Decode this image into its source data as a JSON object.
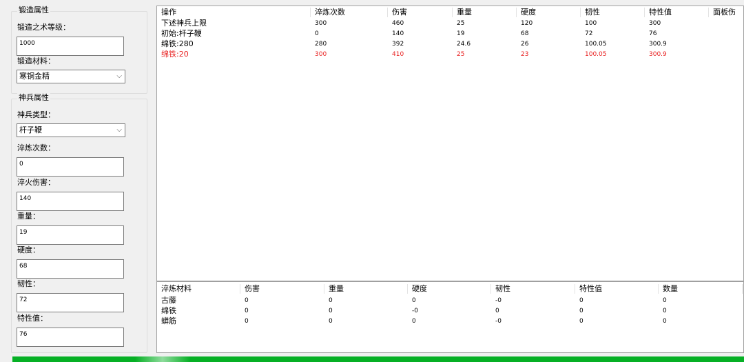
{
  "forge": {
    "title": "锻造属性",
    "level_label": "锻造之术等级：",
    "level_value": "1000",
    "material_label": "锻造材料：",
    "material_value": "寒铜金精"
  },
  "weapon": {
    "title": "神兵属性",
    "type_label": "神兵类型：",
    "type_value": "杆子鞭",
    "fields": [
      {
        "label": "淬炼次数：",
        "value": "0"
      },
      {
        "label": "淬火伤害：",
        "value": "140"
      },
      {
        "label": "重量：",
        "value": "19"
      },
      {
        "label": "硬度：",
        "value": "68"
      },
      {
        "label": "韧性：",
        "value": "72"
      },
      {
        "label": "特性值：",
        "value": "76"
      }
    ]
  },
  "ops_table": {
    "headers": [
      "操作",
      "淬炼次数",
      "伤害",
      "重量",
      "硬度",
      "韧性",
      "特性值",
      "面板伤"
    ],
    "rows": [
      {
        "cells": [
          "下述神兵上限",
          "300",
          "460",
          "25",
          "120",
          "100",
          "300"
        ],
        "highlight": false
      },
      {
        "cells": [
          "初始:杆子鞭",
          "0",
          "140",
          "19",
          "68",
          "72",
          "76"
        ],
        "highlight": false
      },
      {
        "cells": [
          "绵铁:280",
          "280",
          "392",
          "24.6",
          "26",
          "100.05",
          "300.9"
        ],
        "highlight": false
      },
      {
        "cells": [
          "绵铁:20",
          "300",
          "410",
          "25",
          "23",
          "100.05",
          "300.9"
        ],
        "highlight": true
      }
    ]
  },
  "materials_table": {
    "headers": [
      "淬炼材料",
      "伤害",
      "重量",
      "硬度",
      "韧性",
      "特性值",
      "数量"
    ],
    "rows": [
      {
        "cells": [
          "古藤",
          "0",
          "0",
          "0",
          "-0",
          "0",
          "0"
        ]
      },
      {
        "cells": [
          "绵铁",
          "0",
          "0",
          "-0",
          "0",
          "0",
          "0"
        ]
      },
      {
        "cells": [
          "蟒筋",
          "0",
          "0",
          "0",
          "-0",
          "0",
          "0"
        ]
      }
    ]
  },
  "colors": {
    "highlight_row": "#e81e1e",
    "progress": "#06b025"
  },
  "icons": {
    "dropdown": "chevron-down-icon"
  }
}
